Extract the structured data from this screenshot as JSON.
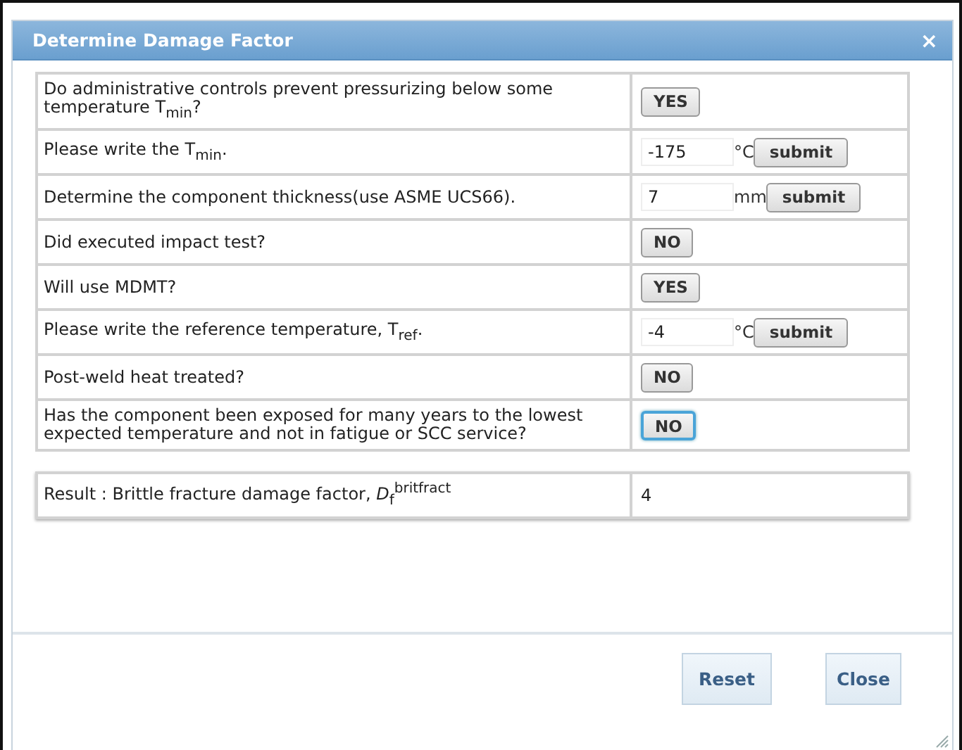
{
  "dialog": {
    "title": "Determine Damage Factor",
    "close_glyph": "×"
  },
  "questions": [
    {
      "kind": "choice",
      "text": "Do administrative controls prevent pressurizing below some temperature T$_{min}$?",
      "answer": "YES",
      "focused": false
    },
    {
      "kind": "input",
      "text": "Please write the T$_{min}$.",
      "value": "-175",
      "unit": "°C",
      "submit": "submit"
    },
    {
      "kind": "input",
      "text": "Determine the component thickness(use ASME UCS66).",
      "value": "7",
      "unit": "mm",
      "submit": "submit"
    },
    {
      "kind": "choice",
      "text": "Did executed impact test?",
      "answer": "NO",
      "focused": false
    },
    {
      "kind": "choice",
      "text": "Will use MDMT?",
      "answer": "YES",
      "focused": false
    },
    {
      "kind": "input",
      "text": "Please write the reference temperature, T$_{ref}$.",
      "value": "-4",
      "unit": "°C",
      "submit": "submit"
    },
    {
      "kind": "choice",
      "text": "Post-weld heat treated?",
      "answer": "NO",
      "focused": false
    },
    {
      "kind": "choice",
      "text": "Has the component been exposed for many years to the lowest expected temperature and not in fatigue or SCC service?",
      "answer": "NO",
      "focused": true
    }
  ],
  "result": {
    "label": "Result : Brittle fracture damage factor, *D*$_{f}$$^{britfract}$",
    "value": "4"
  },
  "buttons": [
    "Reset",
    "Close"
  ]
}
